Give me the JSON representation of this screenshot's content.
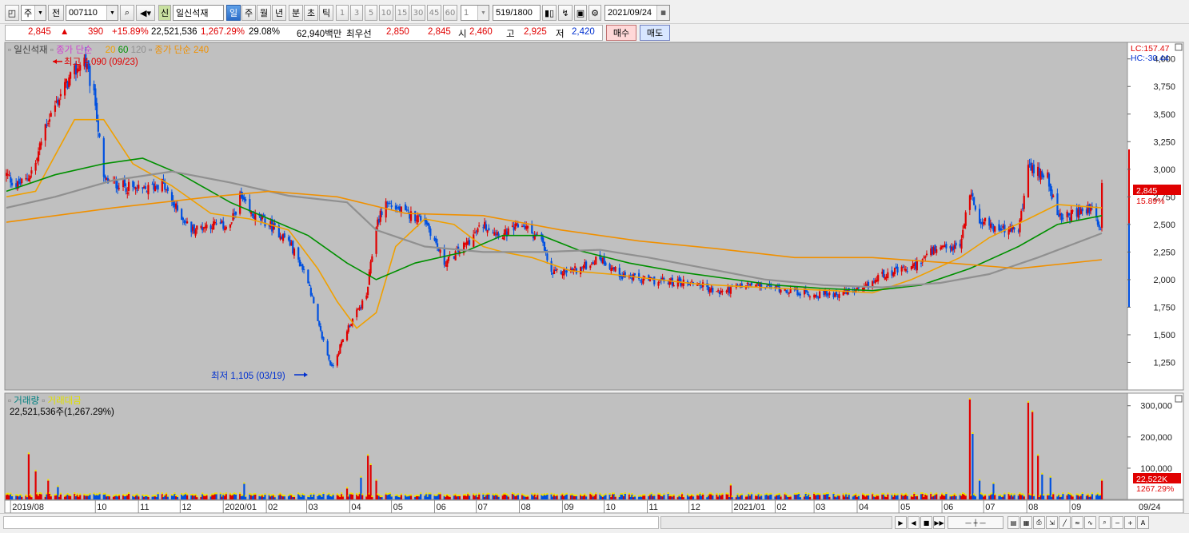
{
  "toolbar": {
    "market_type": "주",
    "scope": "전",
    "code": "007110",
    "stock_badge": "신",
    "stock_name": "일신석재",
    "periods": [
      "일",
      "주",
      "월",
      "년",
      "분",
      "초",
      "틱"
    ],
    "selected_period": "일",
    "intervals": [
      "1",
      "3",
      "5",
      "10",
      "15",
      "30",
      "45",
      "60"
    ],
    "interval_value": "1",
    "count_value": "519",
    "count_total": "/1800",
    "date": "2021/09/24"
  },
  "quote": {
    "price": "2,845",
    "arrow": "▲",
    "change": "390",
    "change_pct": "+15.89%",
    "volume": "22,521,536",
    "volume_pct": "1,267.29%",
    "turnover_pct": "29.08%",
    "trade_value": "62,940백만",
    "best_ask_label": "최우선",
    "best_ask": "2,850",
    "best_bid": "2,845",
    "open_label": "시",
    "open": "2,460",
    "high_label": "고",
    "high": "2,925",
    "low_label": "저",
    "low": "2,420",
    "buy_label": "매수",
    "sell_label": "매도"
  },
  "price_legend": {
    "name": "일신석재",
    "ma_label": "종가 단순",
    "ma_periods": [
      "20",
      "60",
      "120"
    ],
    "ma240_label": "종가 단순 240",
    "colors": {
      "name": "#404040",
      "ma_label": "#d040d0",
      "ma20": "#f0a000",
      "ma60": "#009000",
      "ma120": "#909090",
      "ma240": "#f09000"
    }
  },
  "annotations": {
    "high": "최고 4,090 (09/23)",
    "low": "최저 1,105 (03/19)"
  },
  "right_axis": {
    "lc": "LC:157.47",
    "hc": "HC:-30.44",
    "price_tag": "2,845",
    "pct_tag": "15.89%",
    "vol_tag": "22,522K",
    "vol_pct_tag": "1267.29%"
  },
  "volume_legend": {
    "label1": "거래량",
    "label2": "거래대금",
    "value": "22,521,536주(1,267.29%)"
  },
  "x_axis_labels": [
    "2019/08",
    "10",
    "11",
    "12",
    "2020/01",
    "02",
    "03",
    "04",
    "05",
    "06",
    "07",
    "08",
    "09",
    "10",
    "11",
    "12",
    "2021/01",
    "02",
    "03",
    "04",
    "05",
    "06",
    "07",
    "08",
    "09"
  ],
  "x_axis_end_label": "09/24",
  "chart_data": [
    {
      "type": "candlestick",
      "title": "일신석재",
      "y_ticks": [
        4000,
        3750,
        3500,
        3250,
        3000,
        2750,
        2500,
        2250,
        2000,
        1750,
        1500,
        1250
      ],
      "y_tick_labels": [
        "4,000",
        "3,750",
        "3,500",
        "3,250",
        "3,000",
        "2,750",
        "2,500",
        "2,250",
        "2,000",
        "1,750",
        "1,500",
        "1,250"
      ],
      "ylim": [
        1000,
        4150
      ],
      "x_range": [
        "2019/07/29",
        "2021/09/24"
      ],
      "close_path": [
        [
          "2019-07-29",
          2950
        ],
        [
          "2019-08-05",
          2850
        ],
        [
          "2019-08-12",
          2900
        ],
        [
          "2019-08-19",
          3050
        ],
        [
          "2019-08-26",
          3400
        ],
        [
          "2019-09-09",
          3750
        ],
        [
          "2019-09-23",
          4000
        ],
        [
          "2019-10-01",
          3600
        ],
        [
          "2019-10-07",
          2900
        ],
        [
          "2019-10-21",
          2850
        ],
        [
          "2019-11-04",
          2800
        ],
        [
          "2019-11-18",
          2880
        ],
        [
          "2019-11-25",
          2700
        ],
        [
          "2019-12-09",
          2450
        ],
        [
          "2019-12-23",
          2500
        ],
        [
          "2020-01-06",
          2480
        ],
        [
          "2020-01-13",
          2750
        ],
        [
          "2020-01-20",
          2600
        ],
        [
          "2020-02-03",
          2500
        ],
        [
          "2020-02-17",
          2350
        ],
        [
          "2020-03-02",
          2000
        ],
        [
          "2020-03-09",
          1600
        ],
        [
          "2020-03-19",
          1200
        ],
        [
          "2020-03-30",
          1550
        ],
        [
          "2020-04-13",
          1850
        ],
        [
          "2020-04-20",
          2500
        ],
        [
          "2020-04-27",
          2700
        ],
        [
          "2020-05-11",
          2600
        ],
        [
          "2020-05-25",
          2550
        ],
        [
          "2020-06-08",
          2150
        ],
        [
          "2020-06-22",
          2300
        ],
        [
          "2020-07-06",
          2500
        ],
        [
          "2020-07-20",
          2400
        ],
        [
          "2020-08-03",
          2500
        ],
        [
          "2020-08-17",
          2350
        ],
        [
          "2020-08-24",
          2050
        ],
        [
          "2020-09-14",
          2100
        ],
        [
          "2020-09-28",
          2200
        ],
        [
          "2020-10-12",
          2050
        ],
        [
          "2020-10-26",
          2000
        ],
        [
          "2020-11-16",
          1980
        ],
        [
          "2020-12-07",
          1970
        ],
        [
          "2020-12-21",
          1880
        ],
        [
          "2021-01-11",
          1950
        ],
        [
          "2021-02-01",
          1930
        ],
        [
          "2021-03-01",
          1860
        ],
        [
          "2021-03-22",
          1880
        ],
        [
          "2021-04-05",
          1900
        ],
        [
          "2021-04-19",
          2050
        ],
        [
          "2021-05-10",
          2100
        ],
        [
          "2021-05-24",
          2250
        ],
        [
          "2021-06-14",
          2300
        ],
        [
          "2021-06-21",
          2800
        ],
        [
          "2021-06-28",
          2550
        ],
        [
          "2021-07-12",
          2450
        ],
        [
          "2021-07-26",
          2450
        ],
        [
          "2021-08-02",
          3000
        ],
        [
          "2021-08-16",
          2950
        ],
        [
          "2021-08-23",
          2550
        ],
        [
          "2021-09-06",
          2600
        ],
        [
          "2021-09-17",
          2650
        ],
        [
          "2021-09-23",
          2455
        ],
        [
          "2021-09-24",
          2845
        ]
      ],
      "series_ma": [
        {
          "name": "20",
          "color": "#f0a000",
          "points": [
            [
              "2019-07-29",
              2750
            ],
            [
              "2019-08-19",
              2800
            ],
            [
              "2019-09-16",
              3450
            ],
            [
              "2019-10-07",
              3450
            ],
            [
              "2019-10-28",
              3050
            ],
            [
              "2019-11-25",
              2850
            ],
            [
              "2019-12-23",
              2600
            ],
            [
              "2020-01-20",
              2550
            ],
            [
              "2020-02-17",
              2450
            ],
            [
              "2020-03-09",
              2100
            ],
            [
              "2020-03-23",
              1800
            ],
            [
              "2020-04-06",
              1560
            ],
            [
              "2020-04-20",
              1700
            ],
            [
              "2020-05-04",
              2300
            ],
            [
              "2020-05-25",
              2550
            ],
            [
              "2020-06-15",
              2500
            ],
            [
              "2020-07-06",
              2300
            ],
            [
              "2020-07-20",
              2250
            ],
            [
              "2020-08-10",
              2200
            ],
            [
              "2020-09-07",
              2080
            ],
            [
              "2020-10-05",
              2050
            ],
            [
              "2020-11-02",
              2010
            ],
            [
              "2020-12-07",
              1960
            ],
            [
              "2021-01-04",
              1940
            ],
            [
              "2021-02-08",
              1920
            ],
            [
              "2021-03-15",
              1900
            ],
            [
              "2021-04-12",
              1880
            ],
            [
              "2021-05-10",
              2000
            ],
            [
              "2021-06-14",
              2200
            ],
            [
              "2021-07-05",
              2380
            ],
            [
              "2021-08-02",
              2550
            ],
            [
              "2021-08-23",
              2680
            ],
            [
              "2021-09-24",
              2650
            ]
          ]
        },
        {
          "name": "60",
          "color": "#009000",
          "points": [
            [
              "2019-07-29",
              2800
            ],
            [
              "2019-09-02",
              2950
            ],
            [
              "2019-10-07",
              3050
            ],
            [
              "2019-11-04",
              3100
            ],
            [
              "2019-12-02",
              2950
            ],
            [
              "2020-01-06",
              2700
            ],
            [
              "2020-02-03",
              2550
            ],
            [
              "2020-03-02",
              2400
            ],
            [
              "2020-03-30",
              2150
            ],
            [
              "2020-04-20",
              2000
            ],
            [
              "2020-05-18",
              2150
            ],
            [
              "2020-06-22",
              2250
            ],
            [
              "2020-07-20",
              2400
            ],
            [
              "2020-08-17",
              2400
            ],
            [
              "2020-09-14",
              2260
            ],
            [
              "2020-10-19",
              2150
            ],
            [
              "2020-11-23",
              2070
            ],
            [
              "2020-12-28",
              2010
            ],
            [
              "2021-02-01",
              1950
            ],
            [
              "2021-03-08",
              1920
            ],
            [
              "2021-04-12",
              1900
            ],
            [
              "2021-05-17",
              1950
            ],
            [
              "2021-06-21",
              2100
            ],
            [
              "2021-07-26",
              2300
            ],
            [
              "2021-08-23",
              2500
            ],
            [
              "2021-09-24",
              2580
            ]
          ]
        },
        {
          "name": "120",
          "color": "#909090",
          "points": [
            [
              "2019-07-29",
              2650
            ],
            [
              "2019-09-02",
              2750
            ],
            [
              "2019-10-14",
              2900
            ],
            [
              "2019-11-25",
              2980
            ],
            [
              "2020-01-06",
              2880
            ],
            [
              "2020-02-17",
              2760
            ],
            [
              "2020-03-30",
              2700
            ],
            [
              "2020-04-20",
              2450
            ],
            [
              "2020-05-25",
              2300
            ],
            [
              "2020-07-06",
              2250
            ],
            [
              "2020-08-17",
              2250
            ],
            [
              "2020-09-28",
              2270
            ],
            [
              "2020-11-02",
              2200
            ],
            [
              "2020-12-14",
              2100
            ],
            [
              "2021-01-25",
              2000
            ],
            [
              "2021-03-08",
              1950
            ],
            [
              "2021-04-19",
              1930
            ],
            [
              "2021-05-31",
              1970
            ],
            [
              "2021-07-05",
              2050
            ],
            [
              "2021-08-09",
              2200
            ],
            [
              "2021-09-24",
              2420
            ]
          ]
        },
        {
          "name": "240",
          "color": "#f09000",
          "points": [
            [
              "2019-07-29",
              2520
            ],
            [
              "2019-10-14",
              2650
            ],
            [
              "2019-12-23",
              2750
            ],
            [
              "2020-02-03",
              2800
            ],
            [
              "2020-03-23",
              2750
            ],
            [
              "2020-05-11",
              2600
            ],
            [
              "2020-07-06",
              2580
            ],
            [
              "2020-08-31",
              2450
            ],
            [
              "2020-10-26",
              2350
            ],
            [
              "2020-12-21",
              2280
            ],
            [
              "2021-02-15",
              2200
            ],
            [
              "2021-04-12",
              2200
            ],
            [
              "2021-06-07",
              2150
            ],
            [
              "2021-07-26",
              2100
            ],
            [
              "2021-09-24",
              2180
            ]
          ]
        }
      ]
    },
    {
      "type": "bar",
      "title": "거래량",
      "y_ticks": [
        100000,
        200000,
        300000
      ],
      "y_tick_labels": [
        "100,000",
        "200,000",
        "300,000"
      ],
      "ylim": [
        0,
        330000
      ],
      "spikes": [
        [
          "2019-08-14",
          145000
        ],
        [
          "2019-08-19",
          90000
        ],
        [
          "2019-08-28",
          60000
        ],
        [
          "2019-09-04",
          40000
        ],
        [
          "2020-01-16",
          50000
        ],
        [
          "2020-03-30",
          35000
        ],
        [
          "2020-04-09",
          70000
        ],
        [
          "2020-04-14",
          140000
        ],
        [
          "2020-04-16",
          110000
        ],
        [
          "2020-04-20",
          60000
        ],
        [
          "2020-12-31",
          45000
        ],
        [
          "2021-06-21",
          320000
        ],
        [
          "2021-06-23",
          210000
        ],
        [
          "2021-06-28",
          60000
        ],
        [
          "2021-07-08",
          50000
        ],
        [
          "2021-08-02",
          310000
        ],
        [
          "2021-08-05",
          280000
        ],
        [
          "2021-08-09",
          140000
        ],
        [
          "2021-08-12",
          80000
        ],
        [
          "2021-08-18",
          70000
        ],
        [
          "2021-09-24",
          60000
        ]
      ],
      "baseline": 12000
    }
  ]
}
